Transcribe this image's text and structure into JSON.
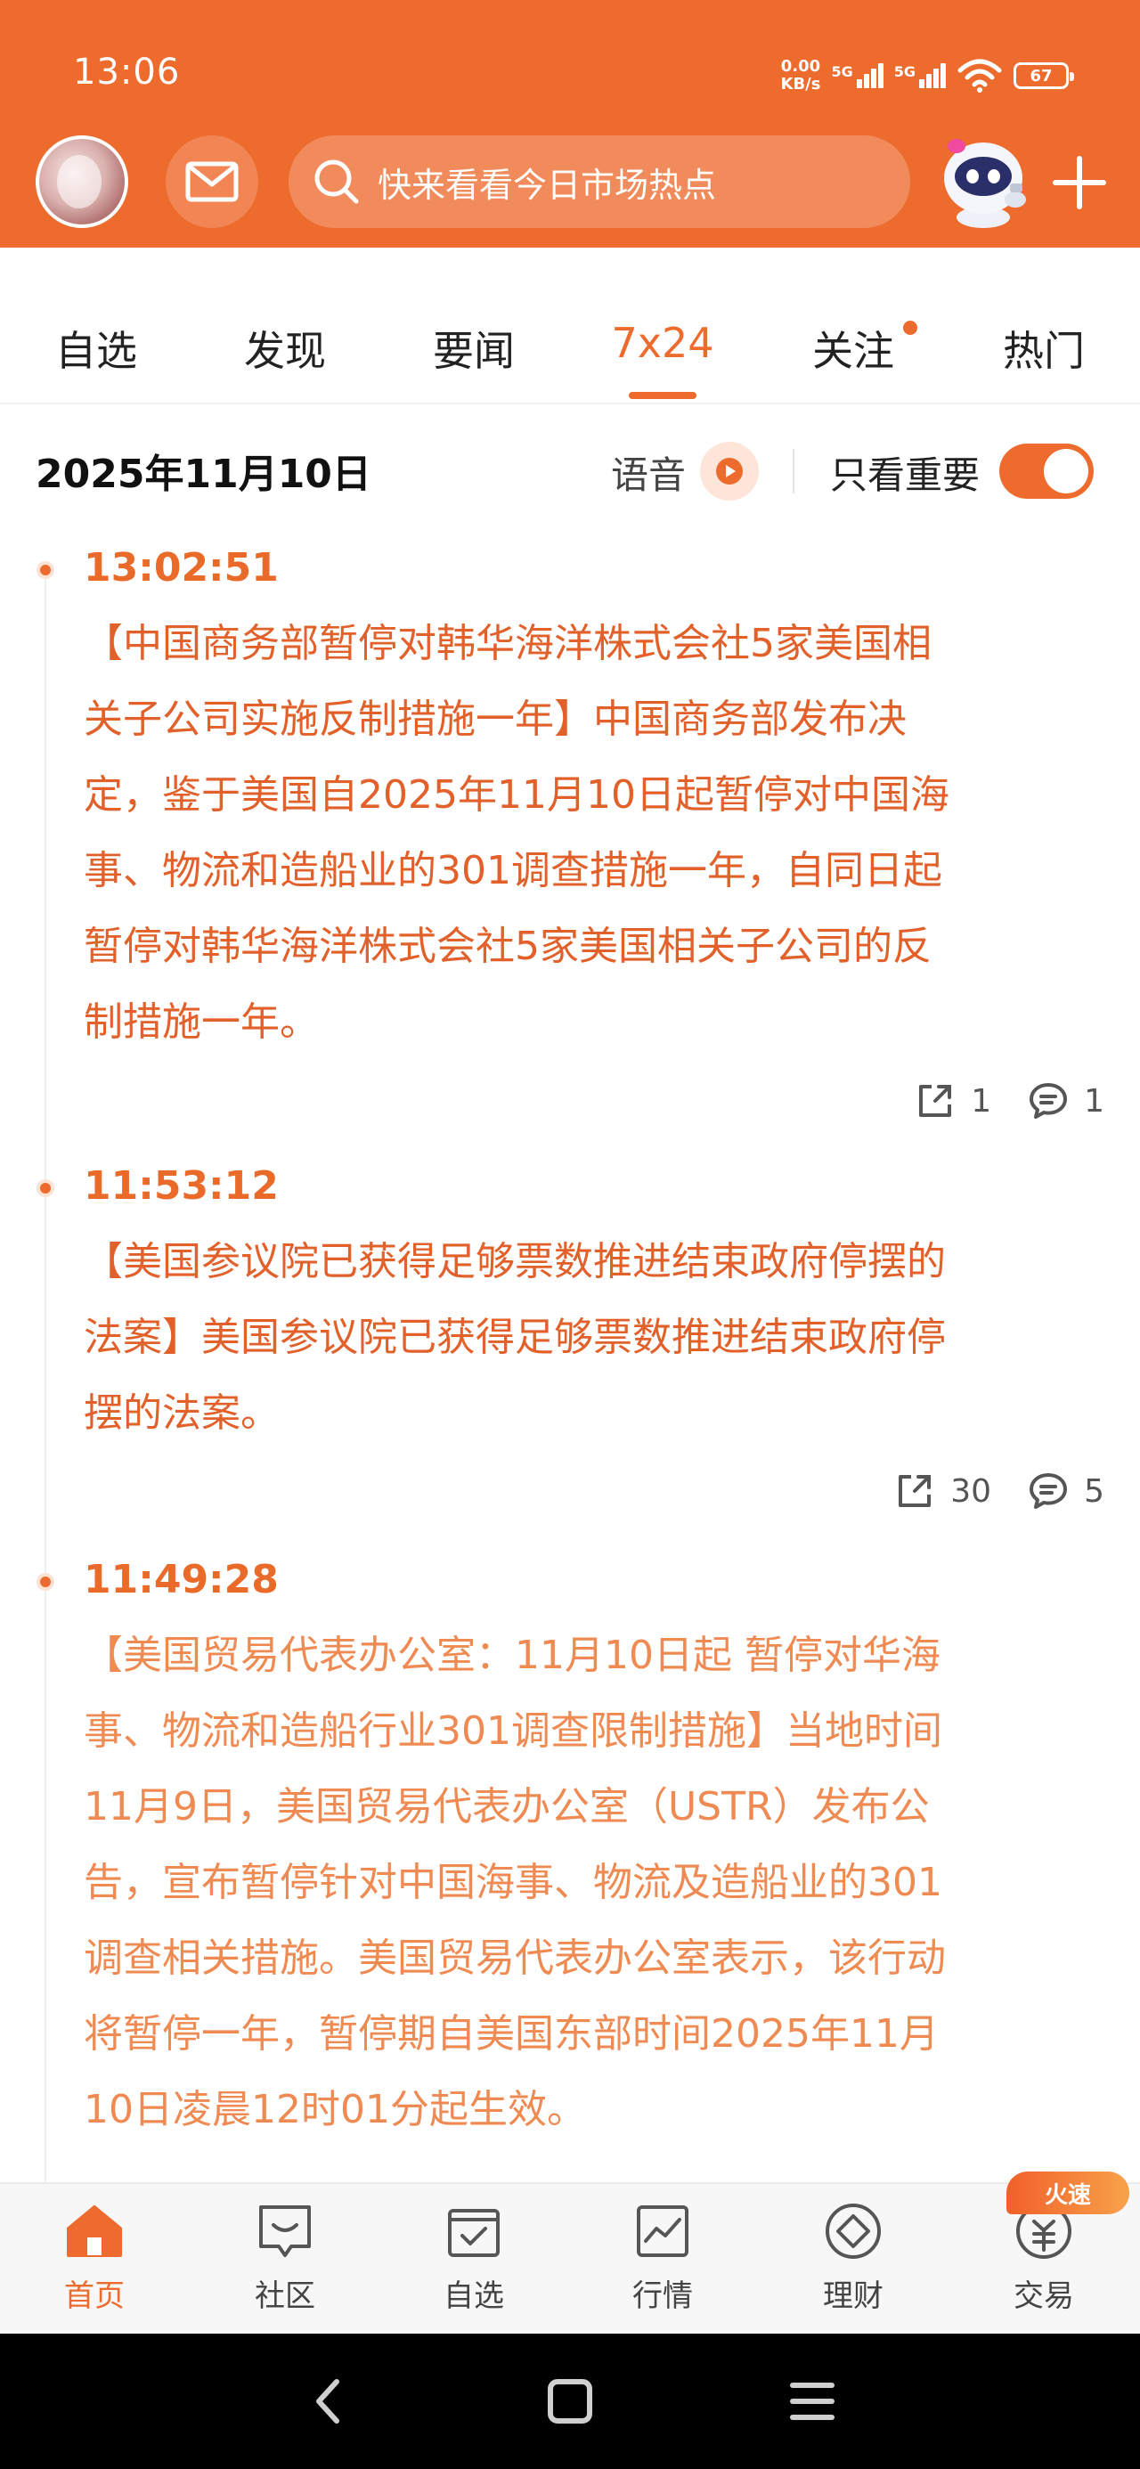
{
  "status_bar": {
    "time": "13:06",
    "net_speed_value": "0.00",
    "net_speed_unit": "KB/s",
    "sim1": "5G",
    "sim2": "5G",
    "battery": "67"
  },
  "header": {
    "search_placeholder": "快来看看今日市场热点",
    "accent_color": "#ee6b2e"
  },
  "tabs": [
    {
      "label": "自选"
    },
    {
      "label": "发现"
    },
    {
      "label": "要闻"
    },
    {
      "label": "7x24"
    },
    {
      "label": "关注"
    },
    {
      "label": "热门"
    }
  ],
  "date_bar": {
    "date": "2025年11月10日",
    "voice_label": "语音",
    "important_only_label": "只看重要",
    "important_only_on": true
  },
  "news": [
    {
      "time": "13:02:51",
      "lines": [
        "【中国商务部暂停对韩华海洋株式会社5家美国相",
        "关子公司实施反制措施一年】中国商务部发布决",
        "定，鉴于美国自2025年11月10日起暂停对中国海",
        "事、物流和造船业的301调查措施一年，自同日起",
        "暂停对韩华海洋株式会社5家美国相关子公司的反",
        "制措施一年。"
      ],
      "shares": "1",
      "comments": "1"
    },
    {
      "time": "11:53:12",
      "lines": [
        "【美国参议院已获得足够票数推进结束政府停摆的",
        "法案】美国参议院已获得足够票数推进结束政府停",
        "摆的法案。"
      ],
      "shares": "30",
      "comments": "5"
    },
    {
      "time": "11:49:28",
      "lines": [
        "【美国贸易代表办公室：11月10日起 暂停对华海",
        "事、物流和造船行业301调查限制措施】当地时间",
        "11月9日，美国贸易代表办公室（USTR）发布公",
        "告，宣布暂停针对中国海事、物流及造船业的301",
        "调查相关措施。美国贸易代表办公室表示，该行动",
        "将暂停一年，暂停期自美国东部时间2025年11月",
        "10日凌晨12时01分起生效。"
      ]
    }
  ],
  "bottom_nav": [
    {
      "label": "首页",
      "icon": "home-icon"
    },
    {
      "label": "社区",
      "icon": "community-icon"
    },
    {
      "label": "自选",
      "icon": "watchlist-icon"
    },
    {
      "label": "行情",
      "icon": "market-icon"
    },
    {
      "label": "理财",
      "icon": "wealth-icon"
    },
    {
      "label": "交易",
      "icon": "trade-icon"
    }
  ],
  "trade_badge": "火速"
}
